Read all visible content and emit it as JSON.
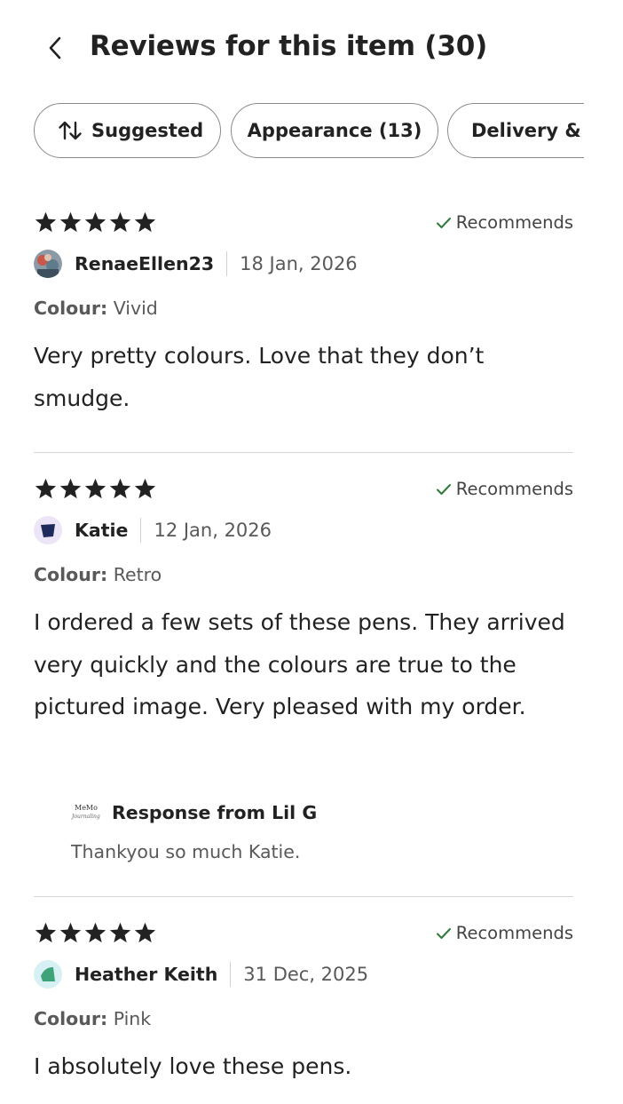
{
  "header": {
    "title": "Reviews for this item (30)",
    "back_icon": "chevron-left-icon"
  },
  "filters": [
    {
      "label": "Suggested",
      "icon": "sort-arrows-icon"
    },
    {
      "label": "Appearance (13)"
    },
    {
      "label": "Delivery & P"
    }
  ],
  "colour_label": "Colour:",
  "recommends_label": "Recommends",
  "reviews": [
    {
      "rating": 5,
      "user": "RenaeEllen23",
      "date": "18 Jan, 2026",
      "colour": "Vivid",
      "text": "Very pretty colours. Love that they don’t smudge.",
      "recommends": true
    },
    {
      "rating": 5,
      "user": "Katie",
      "date": "12 Jan, 2026",
      "colour": "Retro",
      "text": "I ordered a few sets of these pens. They arrived very quickly and the colours are true to the pictured image. Very pleased with my order.",
      "recommends": true,
      "response": {
        "title": "Response from Lil G",
        "text": "Thankyou so much Katie.",
        "logo_text": "MeMo",
        "logo_subtext": "Journaling"
      }
    },
    {
      "rating": 5,
      "user": "Heather Keith",
      "date": "31 Dec, 2025",
      "colour": "Pink",
      "text": "I absolutely love these pens.",
      "recommends": true
    }
  ],
  "colors": {
    "text": "#222222",
    "muted": "#595959",
    "border": "#8a8a8a",
    "divider": "#d7d7d7",
    "check": "#2f7a3b"
  }
}
